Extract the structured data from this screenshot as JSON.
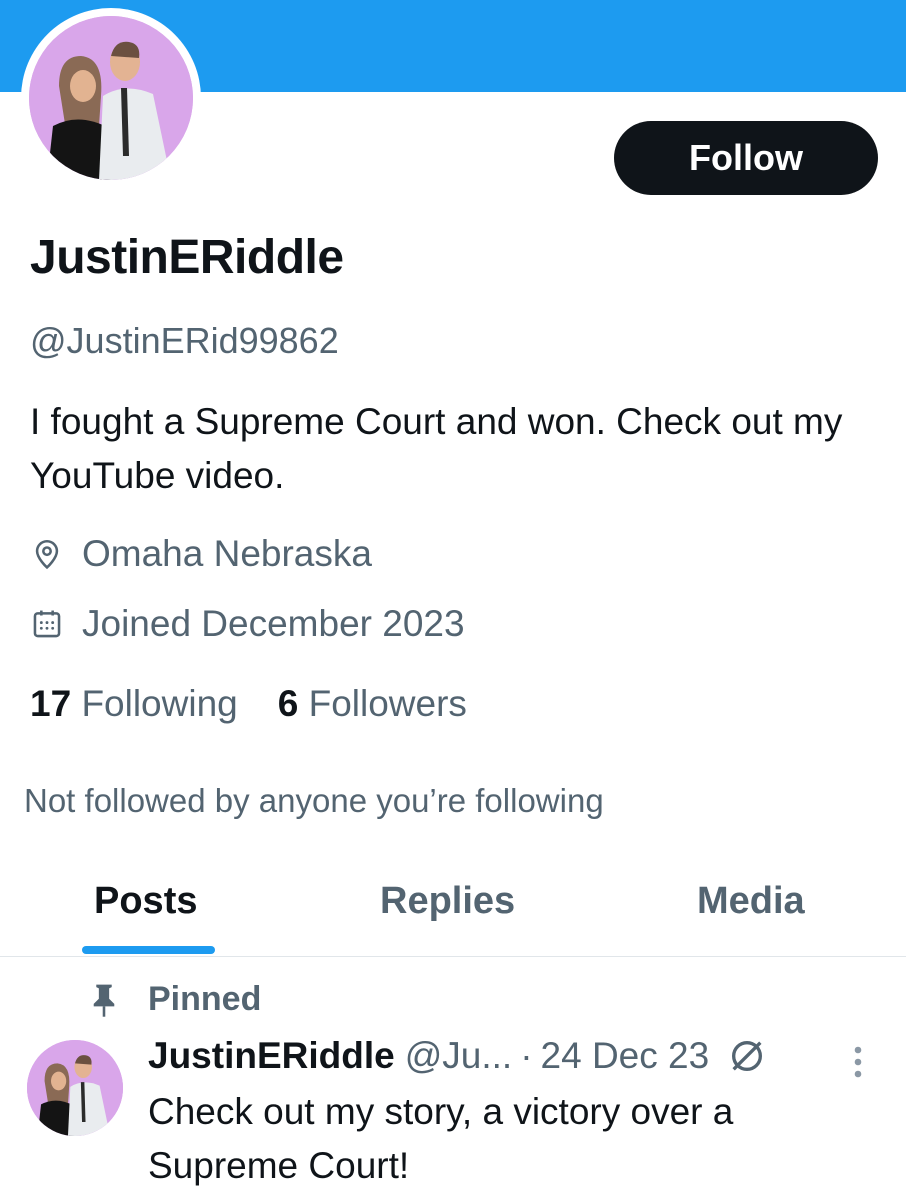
{
  "profile": {
    "display_name": "JustinERiddle",
    "handle": "@JustinERid99862",
    "bio": "I fought a Supreme Court and won. Check out my YouTube video.",
    "location": "Omaha Nebraska",
    "joined": "Joined December 2023",
    "following_count": "17",
    "following_label": "Following",
    "followers_count": "6",
    "followers_label": "Followers",
    "not_followed_text": "Not followed by anyone you’re following"
  },
  "actions": {
    "follow_label": "Follow"
  },
  "tabs": [
    {
      "label": "Posts",
      "active": true
    },
    {
      "label": "Replies",
      "active": false
    },
    {
      "label": "Media",
      "active": false
    }
  ],
  "pinned_post": {
    "pinned_label": "Pinned",
    "author_name": "JustinERiddle",
    "author_handle": "@Ju...",
    "date": "24 Dec 23",
    "text": "Check out my story, a victory over a Supreme Court!"
  },
  "colors": {
    "accent": "#1d9bf0",
    "text_primary": "#0f1419",
    "text_secondary": "#536471"
  },
  "icons": {
    "location": "location-pin-icon",
    "calendar": "calendar-icon",
    "pin": "pin-icon",
    "grok": "grok-icon",
    "more": "more-vertical-icon"
  }
}
